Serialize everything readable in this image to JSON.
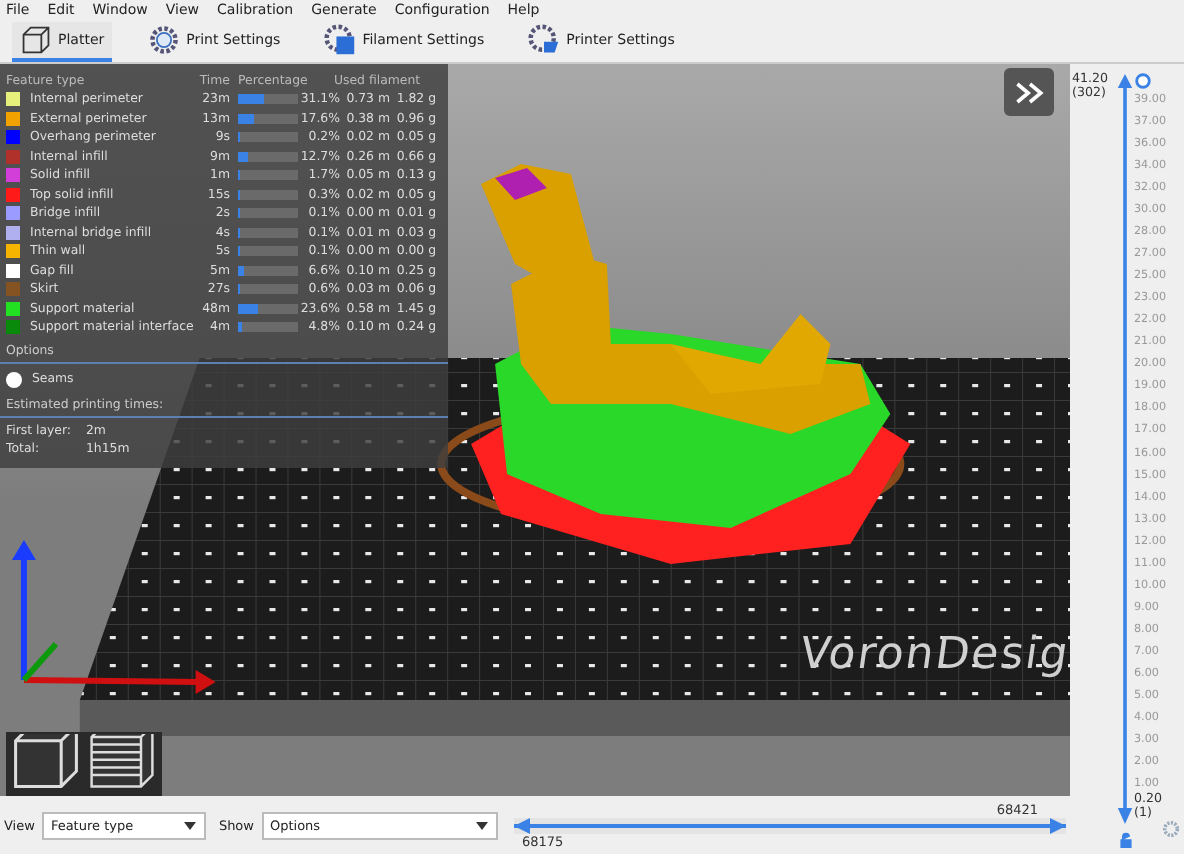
{
  "menu": [
    "File",
    "Edit",
    "Window",
    "View",
    "Calibration",
    "Generate",
    "Configuration",
    "Help"
  ],
  "tabs": [
    {
      "label": "Platter",
      "selected": true
    },
    {
      "label": "Print Settings",
      "selected": false
    },
    {
      "label": "Filament Settings",
      "selected": false
    },
    {
      "label": "Printer Settings",
      "selected": false
    }
  ],
  "legend": {
    "columns": [
      "Feature type",
      "Time",
      "Percentage",
      "Used filament"
    ],
    "items": [
      {
        "name": "Internal perimeter",
        "time": "23m",
        "level": 0.43,
        "percent": "31.1%",
        "length": "0.73 m",
        "weight": "1.82 g",
        "color": "#e6f07a"
      },
      {
        "name": "External perimeter",
        "time": "13m",
        "level": 0.25,
        "percent": "17.6%",
        "length": "0.38 m",
        "weight": "0.96 g",
        "color": "#f2a200"
      },
      {
        "name": "Overhang perimeter",
        "time": "9s",
        "level": 0.01,
        "percent": "0.2%",
        "length": "0.02 m",
        "weight": "0.05 g",
        "color": "#0000ff"
      },
      {
        "name": "Internal infill",
        "time": "9m",
        "level": 0.18,
        "percent": "12.7%",
        "length": "0.26 m",
        "weight": "0.66 g",
        "color": "#b0302a"
      },
      {
        "name": "Solid infill",
        "time": "1m",
        "level": 0.02,
        "percent": "1.7%",
        "length": "0.05 m",
        "weight": "0.13 g",
        "color": "#d23ed8"
      },
      {
        "name": "Top solid infill",
        "time": "15s",
        "level": 0.01,
        "percent": "0.3%",
        "length": "0.02 m",
        "weight": "0.05 g",
        "color": "#ff1a1a"
      },
      {
        "name": "Bridge infill",
        "time": "2s",
        "level": 0.01,
        "percent": "0.1%",
        "length": "0.00 m",
        "weight": "0.01 g",
        "color": "#9a9aff"
      },
      {
        "name": "Internal bridge infill",
        "time": "4s",
        "level": 0.01,
        "percent": "0.1%",
        "length": "0.01 m",
        "weight": "0.03 g",
        "color": "#b0b0f0"
      },
      {
        "name": "Thin wall",
        "time": "5s",
        "level": 0.01,
        "percent": "0.1%",
        "length": "0.00 m",
        "weight": "0.00 g",
        "color": "#f5b400"
      },
      {
        "name": "Gap fill",
        "time": "5m",
        "level": 0.09,
        "percent": "6.6%",
        "length": "0.10 m",
        "weight": "0.25 g",
        "color": "#ffffff"
      },
      {
        "name": "Skirt",
        "time": "27s",
        "level": 0.01,
        "percent": "0.6%",
        "length": "0.03 m",
        "weight": "0.06 g",
        "color": "#845321"
      },
      {
        "name": "Support material",
        "time": "48m",
        "level": 0.33,
        "percent": "23.6%",
        "length": "0.58 m",
        "weight": "1.45 g",
        "color": "#22e022"
      },
      {
        "name": "Support material interface",
        "time": "4m",
        "level": 0.07,
        "percent": "4.8%",
        "length": "0.10 m",
        "weight": "0.24 g",
        "color": "#0a8a0a"
      }
    ],
    "options_title": "Options",
    "options": [
      {
        "label": "Seams",
        "color": "#ffffff"
      }
    ],
    "times_title": "Estimated printing times:",
    "times": [
      {
        "label": "First layer:",
        "value": "2m"
      },
      {
        "label": "Total:",
        "value": "1h15m"
      }
    ]
  },
  "bed_logo": "VoronDesig",
  "layer_slider": {
    "level": 1,
    "top_value": "41.20",
    "top_index": "(302)",
    "bottom_value": "0.20",
    "bottom_index": "(1)",
    "ticks": [
      "39.00",
      "37.00",
      "36.00",
      "34.00",
      "32.00",
      "30.00",
      "28.00",
      "27.00",
      "25.00",
      "23.00",
      "22.00",
      "21.00",
      "20.00",
      "19.00",
      "18.00",
      "17.00",
      "16.00",
      "15.00",
      "14.00",
      "13.00",
      "12.00",
      "11.00",
      "10.00",
      "9.00",
      "8.00",
      "7.00",
      "6.00",
      "5.00",
      "4.00",
      "3.00",
      "2.00",
      "1.00"
    ]
  },
  "move_slider": {
    "level": 1,
    "upper": "68421",
    "lower": "68175"
  },
  "bottom_bar": {
    "view_label": "View",
    "view_value": "Feature type",
    "show_label": "Show",
    "show_value": "Options"
  }
}
